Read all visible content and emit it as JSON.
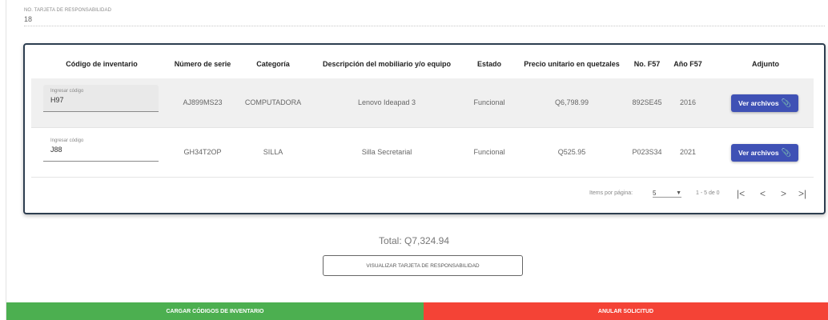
{
  "responsibility_card": {
    "label": "NO. TARJETA DE RESPONSABILIDAD",
    "value": "18"
  },
  "table": {
    "headers": [
      "Código de inventario",
      "Número de serie",
      "Categoría",
      "Descripción del mobiliario y/o equipo",
      "Estado",
      "Precio unitario en quetzales",
      "No. F57",
      "Año F57",
      "Adjunto"
    ],
    "rows": [
      {
        "code_placeholder": "Ingresar código",
        "code": "H97",
        "serial": "AJ899MS23",
        "category": "COMPUTADORA",
        "description": "Lenovo Ideapad 3",
        "status": "Funcional",
        "price": "Q6,798.99",
        "f57": "892SE45",
        "year": "2016",
        "attachment_label": "Ver archivos"
      },
      {
        "code_placeholder": "Ingresar código",
        "code": "J88",
        "serial": "GH34T2OP",
        "category": "SILLA",
        "description": "Silla Secretarial",
        "status": "Funcional",
        "price": "Q525.95",
        "f57": "P023S34",
        "year": "2021",
        "attachment_label": "Ver archivos"
      }
    ]
  },
  "paginator": {
    "items_per_page_label": "Items por página:",
    "page_size": "5",
    "range": "1 - 5 de 0",
    "first": "|<",
    "prev": "<",
    "next": ">",
    "last": ">|"
  },
  "total": "Total: Q7,324.94",
  "actions": {
    "visualize": "VISUALIZAR TARJETA DE RESPONSABILIDAD",
    "load_codes": "CARGAR CÓDIGOS DE INVENTARIO",
    "cancel_request": "ANULAR SOLICITUD"
  },
  "colors": {
    "primary": "#3f51b5",
    "success": "#4caf50",
    "danger": "#f44336",
    "card_border": "#2d3e50"
  },
  "icons": {
    "attachment": "paperclip-icon",
    "dropdown": "chevron-down-icon"
  }
}
